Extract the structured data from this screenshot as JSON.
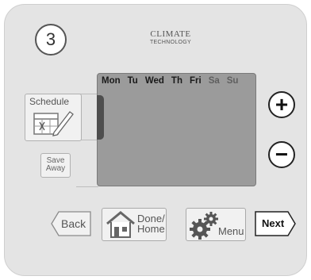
{
  "step_number": "3",
  "brand": {
    "line1": "CLIMATE",
    "line2": "TECHNOLOGY"
  },
  "display": {
    "days": [
      "Mon",
      "Tu",
      "Wed",
      "Th",
      "Fri",
      "Sa",
      "Su"
    ]
  },
  "buttons": {
    "schedule": "Schedule",
    "save_away": [
      "Save",
      "Away"
    ],
    "plus": "+",
    "minus": "−",
    "back": "Back",
    "done_home": [
      "Done/",
      "Home"
    ],
    "menu": "Menu",
    "next": "Next"
  },
  "icons": {
    "schedule": "calendar-pencil-icon",
    "done_home": "house-icon",
    "menu": "gears-icon"
  }
}
